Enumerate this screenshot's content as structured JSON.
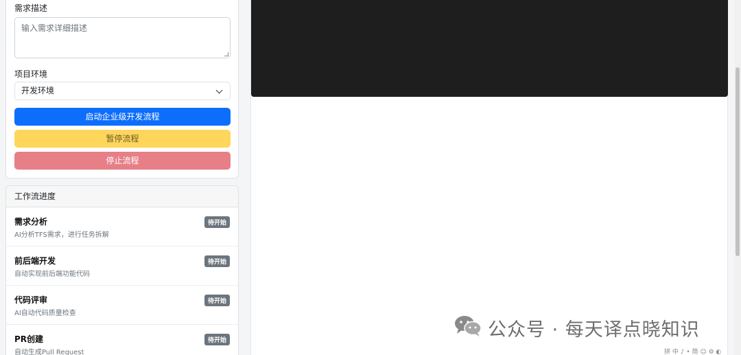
{
  "form": {
    "desc_label": "需求描述",
    "desc_placeholder": "输入需求详细描述",
    "env_label": "项目环境",
    "env_value": "开发环境",
    "start_button": "启动企业级开发流程",
    "pause_button": "暂停流程",
    "stop_button": "停止流程"
  },
  "workflow": {
    "header": "工作流进度",
    "items": [
      {
        "title": "需求分析",
        "desc": "AI分析TFS需求，进行任务拆解",
        "status": "待开始"
      },
      {
        "title": "前后端开发",
        "desc": "自动实现前后端功能代码",
        "status": "待开始"
      },
      {
        "title": "代码评审",
        "desc": "AI自动代码质量检查",
        "status": "待开始"
      },
      {
        "title": "PR创建",
        "desc": "自动生成Pull Request",
        "status": "待开始"
      }
    ]
  },
  "watermark": {
    "text": "公众号 · 每天译点晓知识"
  },
  "tray": {
    "text": "拼 中 ♪ • 简 ☺ ⚙ ◐"
  },
  "colors": {
    "primary": "#0d6efd",
    "warning": "#ffd65c",
    "danger": "#e77f87",
    "badge": "#6c757d",
    "terminal": "#1e1e1e"
  }
}
